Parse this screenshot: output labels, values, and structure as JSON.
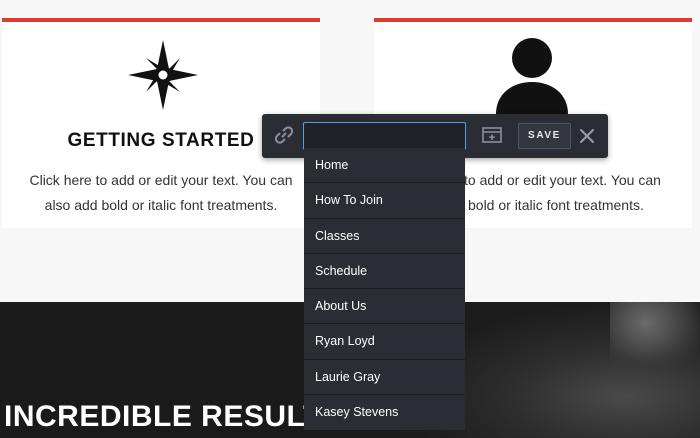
{
  "cards": [
    {
      "icon": "compass-star-icon",
      "title": "GETTING STARTED",
      "body_line1": "Click here to add or edit your text. You can",
      "body_line2": "also add bold or italic font treatments."
    },
    {
      "icon": "person-icon",
      "body_line1": "to add or edit your text. You can",
      "body_line2": "bold or italic font treatments."
    }
  ],
  "section": {
    "headline": "INCREDIBLE RESULTS"
  },
  "link_editor": {
    "link_icon": "link-icon",
    "url_value": "",
    "new_tab_icon": "new-window-icon",
    "save_label": "SAVE",
    "close_icon": "close-icon",
    "input_border_color": "#4ea1e8"
  },
  "page_list": [
    "Home",
    "How To Join",
    "Classes",
    "Schedule",
    "About Us",
    "Ryan Loyd",
    "Laurie Gray",
    "Kasey Stevens"
  ],
  "colors": {
    "accent_red": "#e03a2f",
    "toolbar_bg": "#2a2d33",
    "dark_section": "#1a1a1a"
  }
}
